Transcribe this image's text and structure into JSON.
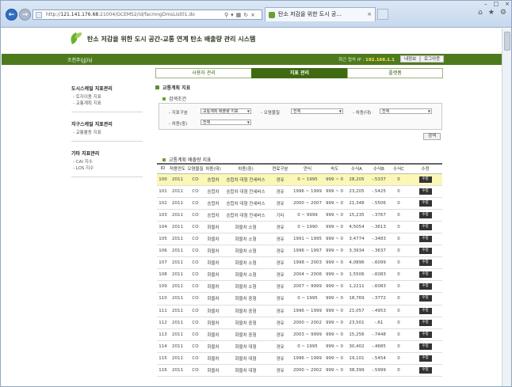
{
  "browser": {
    "address": {
      "prefix": "http://",
      "host": "121.141.176.68",
      "path": ":21004/GCEMS2/id/facmngDmsList01.do"
    },
    "tab_title": "탄소 저감을 위한 도시 공...",
    "tab_close": "×"
  },
  "header": {
    "title": "탄소 저감을 위한 도시 공간-교통 연계 탄소 배출량 관리 시스템"
  },
  "userbar": {
    "user": "조천주(jjj)님",
    "ip_label": "최근 접속 IP :",
    "ip_value": "192.168.1.1",
    "my_info": "내정보",
    "logout": "로그아웃"
  },
  "gnb": [
    {
      "label": "사용자 관리",
      "active": false
    },
    {
      "label": "지표 관리",
      "active": true
    },
    {
      "label": "플랫폼",
      "active": false
    }
  ],
  "sidebar": [
    {
      "title": "도시스케일 지표관리",
      "items": [
        "- 토지이용 지표",
        "- 교통계획 지표"
      ]
    },
    {
      "title": "지구스케일 지표관리",
      "items": [
        "- 교통활동 지표"
      ]
    },
    {
      "title": "기타 지표관리",
      "items": [
        "- CAI 지수",
        "- LOS 지수"
      ]
    }
  ],
  "content": {
    "section_title": "교통계획 지표",
    "search_title": "검색조건",
    "filters": {
      "f1_label": "- 지표구분",
      "f1_value": "교통계획 배출량 지표",
      "f2_label": "- 오염물질",
      "f2_value": "전체",
      "f3_label": "- 차종(대)",
      "f3_value": "전체",
      "f4_label": "- 차종(중)",
      "f4_value": "전체"
    },
    "search_button": "검색",
    "table_title": "교통계획 배출량 지표"
  },
  "table": {
    "headers": [
      "ID",
      "적용연도",
      "오염물질",
      "차종(대)",
      "차종(중)",
      "연료구분",
      "연식",
      "속도",
      "수식A",
      "수식B",
      "수식C",
      "수정"
    ],
    "edit_label": "수정",
    "rows": [
      [
        "100",
        "2011",
        "CO",
        "승합차",
        "승합차 대형 전세버스",
        "경유",
        "0 ~ 1995",
        "999 ~ 0",
        "28,205",
        "-.5337",
        "0"
      ],
      [
        "101",
        "2011",
        "CO",
        "승합차",
        "승합차 대형 전세버스",
        "경유",
        "1996 ~ 1999",
        "999 ~ 0",
        "23,205",
        "-.5425",
        "0"
      ],
      [
        "102",
        "2011",
        "CO",
        "승합차",
        "승합차 대형 전세버스",
        "경유",
        "2000 ~ 2007",
        "999 ~ 0",
        "21,348",
        "-.5506",
        "0"
      ],
      [
        "103",
        "2011",
        "CO",
        "승합차",
        "승합차 대형 전세버스",
        "기타",
        "0 ~ 9999",
        "999 ~ 0",
        "15,235",
        "-.3767",
        "0"
      ],
      [
        "104",
        "2011",
        "CO",
        "화물차",
        "화물차 소형",
        "경유",
        "0 ~ 1990",
        "999 ~ 0",
        "4,5054",
        "-.3613",
        "0"
      ],
      [
        "105",
        "2011",
        "CO",
        "화물차",
        "화물차 소형",
        "경유",
        "1991 ~ 1995",
        "999 ~ 0",
        "3,4774",
        "-.3483",
        "0"
      ],
      [
        "106",
        "2011",
        "CO",
        "화물차",
        "화물차 소형",
        "경유",
        "1996 ~ 1997",
        "999 ~ 0",
        "3,3934",
        "-.3637",
        "0"
      ],
      [
        "107",
        "2011",
        "CO",
        "화물차",
        "화물차 소형",
        "경유",
        "1998 ~ 2003",
        "999 ~ 0",
        "4,0896",
        "-.6099",
        "0"
      ],
      [
        "108",
        "2011",
        "CO",
        "화물차",
        "화물차 소형",
        "경유",
        "2004 ~ 2006",
        "999 ~ 0",
        "1,5506",
        "-.6083",
        "0"
      ],
      [
        "109",
        "2011",
        "CO",
        "화물차",
        "화물차 소형",
        "경유",
        "2007 ~ 9999",
        "999 ~ 0",
        "1,2211",
        "-.6083",
        "0"
      ],
      [
        "110",
        "2011",
        "CO",
        "화물차",
        "화물차 중형",
        "경유",
        "0 ~ 1995",
        "999 ~ 0",
        "18,769",
        "-.3772",
        "0"
      ],
      [
        "111",
        "2011",
        "CO",
        "화물차",
        "화물차 중형",
        "경유",
        "1996 ~ 1999",
        "999 ~ 0",
        "21,057",
        "-.4953",
        "0"
      ],
      [
        "112",
        "2011",
        "CO",
        "화물차",
        "화물차 중형",
        "경유",
        "2000 ~ 2002",
        "999 ~ 0",
        "23,501",
        "-.61",
        "0"
      ],
      [
        "113",
        "2011",
        "CO",
        "화물차",
        "화물차 중형",
        "경유",
        "2003 ~ 9999",
        "999 ~ 0",
        "15,256",
        "-.7448",
        "0"
      ],
      [
        "114",
        "2011",
        "CO",
        "화물차",
        "화물차 대형",
        "경유",
        "0 ~ 1995",
        "999 ~ 0",
        "30,402",
        "-.4685",
        "0"
      ],
      [
        "115",
        "2011",
        "CO",
        "화물차",
        "화물차 대형",
        "경유",
        "1996 ~ 1999",
        "999 ~ 0",
        "19,101",
        "-.5454",
        "0"
      ],
      [
        "116",
        "2011",
        "CO",
        "화물차",
        "화물차 대형",
        "경유",
        "2000 ~ 2002",
        "999 ~ 0",
        "38,399",
        "-.5999",
        "0"
      ]
    ]
  }
}
